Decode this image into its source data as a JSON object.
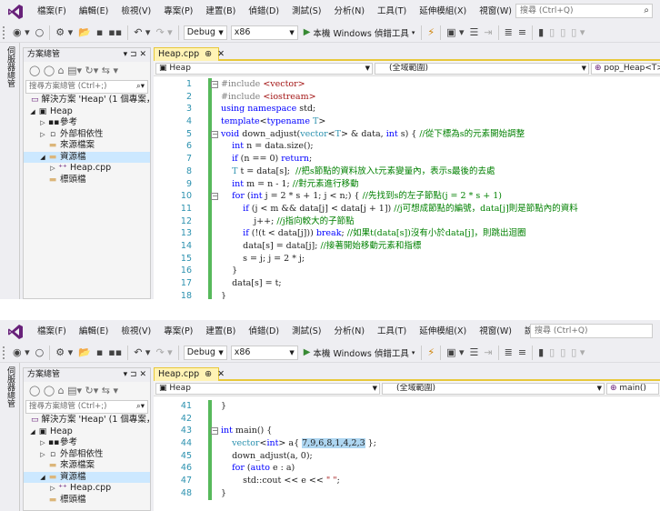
{
  "menu": {
    "items": [
      "檔案(F)",
      "編輯(E)",
      "檢視(V)",
      "專案(P)",
      "建置(B)",
      "偵錯(D)",
      "測試(S)",
      "分析(N)",
      "工具(T)",
      "延伸模組(X)",
      "視窗(W)",
      "說明(H)"
    ],
    "quick_launch_placeholder": "搜尋 (Ctrl+Q)"
  },
  "toolbar": {
    "config": "Debug",
    "platform": "x86",
    "run_label": "本機 Windows 偵錯工具"
  },
  "left_strip": {
    "label": "伺服器總管"
  },
  "solution_explorer": {
    "title": "方案總管",
    "pin": "▾ ⊐ ✕",
    "search_placeholder": "搜尋方案總管 (Ctrl+;)",
    "tree": [
      {
        "label": "解決方案 'Heap' (1 個專案，共",
        "icon": "solution-icon",
        "depth": 0,
        "exp": ""
      },
      {
        "label": "Heap",
        "icon": "project-icon",
        "depth": 0,
        "exp": "◢"
      },
      {
        "label": "參考",
        "icon": "references-icon",
        "depth": 1,
        "exp": "▷"
      },
      {
        "label": "外部相依性",
        "icon": "external-deps-icon",
        "depth": 1,
        "exp": "▷"
      },
      {
        "label": "來源檔案",
        "icon": "folder-icon",
        "depth": 1,
        "exp": ""
      },
      {
        "label": "資源檔",
        "icon": "folder-icon",
        "depth": 1,
        "exp": "◢"
      },
      {
        "label": "Heap.cpp",
        "icon": "cpp-file-icon",
        "depth": 2,
        "exp": "▷"
      },
      {
        "label": "標頭檔",
        "icon": "folder-icon",
        "depth": 1,
        "exp": ""
      }
    ]
  },
  "editor_top": {
    "tab": {
      "label": "Heap.cpp",
      "pin": "⊕",
      "close": "✕"
    },
    "nav": {
      "project": "Heap",
      "scope": "(全域範圍)",
      "member": "pop_Heap<T>"
    },
    "lines": [
      {
        "n": "1",
        "code": [
          [
            "pp",
            "#include "
          ],
          [
            "str",
            "<vector>"
          ]
        ]
      },
      {
        "n": "2",
        "code": [
          [
            "pp",
            "#include "
          ],
          [
            "str",
            "<iostream>"
          ]
        ]
      },
      {
        "n": "3",
        "code": [
          [
            "kw",
            "using namespace "
          ],
          [
            "",
            "std;"
          ]
        ]
      },
      {
        "n": "4",
        "code": [
          [
            "kw",
            "template"
          ],
          [
            "",
            "<"
          ],
          [
            "kw",
            "typename "
          ],
          [
            "ty",
            "T"
          ],
          [
            "",
            ">"
          ]
        ]
      },
      {
        "n": "5",
        "code": [
          [
            "kw",
            "void "
          ],
          [
            "",
            "down_adjust("
          ],
          [
            "ty",
            "vector"
          ],
          [
            "",
            "<"
          ],
          [
            "ty",
            "T"
          ],
          [
            "",
            "> & data, "
          ],
          [
            "kw",
            "int "
          ],
          [
            "",
            "s) { "
          ],
          [
            "cm",
            "//從下標為s的元素開始調整"
          ]
        ]
      },
      {
        "n": "6",
        "code": [
          [
            "kw",
            "    int "
          ],
          [
            "",
            "n = data.size();"
          ]
        ]
      },
      {
        "n": "7",
        "code": [
          [
            "kw",
            "    if "
          ],
          [
            "",
            "(n == 0) "
          ],
          [
            "kw",
            "return"
          ],
          [
            "",
            ";"
          ]
        ]
      },
      {
        "n": "8",
        "code": [
          [
            "ty",
            "    T "
          ],
          [
            "",
            "t = data[s];  "
          ],
          [
            "cm",
            "//把s節點的資料放入t元素變量內，表示s最後的去處"
          ]
        ]
      },
      {
        "n": "9",
        "code": [
          [
            "kw",
            "    int "
          ],
          [
            "",
            "m = n - 1; "
          ],
          [
            "cm",
            "//對元素進行移動"
          ]
        ]
      },
      {
        "n": "10",
        "code": [
          [
            "kw",
            "    for "
          ],
          [
            "",
            "("
          ],
          [
            "kw",
            "int "
          ],
          [
            "",
            "j = 2 * s + 1; j < n;) { "
          ],
          [
            "cm",
            "//先找到s的左子節點(j = 2 * s + 1)"
          ]
        ]
      },
      {
        "n": "11",
        "code": [
          [
            "kw",
            "        if "
          ],
          [
            "",
            "(j < m && data[j] < data[j + 1]) "
          ],
          [
            "cm",
            "//j可想成節點的編號，data[j]則是節點內的資料"
          ]
        ]
      },
      {
        "n": "12",
        "code": [
          [
            "",
            "            j++; "
          ],
          [
            "cm",
            "//j指向較大的子節點"
          ]
        ]
      },
      {
        "n": "13",
        "code": [
          [
            "kw",
            "        if "
          ],
          [
            "",
            "(!(t < data[j])) "
          ],
          [
            "kw",
            "break"
          ],
          [
            "",
            "; "
          ],
          [
            "cm",
            "//如果t(data[s])沒有小於data[j]，則跳出迴圈"
          ]
        ]
      },
      {
        "n": "14",
        "code": [
          [
            "",
            "        data[s] = data[j]; "
          ],
          [
            "cm",
            "//接著開始移動元素和指標"
          ]
        ]
      },
      {
        "n": "15",
        "code": [
          [
            "",
            "        s = j; j = 2 * j;"
          ]
        ]
      },
      {
        "n": "16",
        "code": [
          [
            "",
            "    }"
          ]
        ]
      },
      {
        "n": "17",
        "code": [
          [
            "",
            "    data[s] = t;"
          ]
        ]
      },
      {
        "n": "18",
        "code": [
          [
            "",
            "}"
          ]
        ]
      }
    ]
  },
  "editor_bottom": {
    "tab": {
      "label": "Heap.cpp",
      "pin": "⊕",
      "close": "✕"
    },
    "nav": {
      "project": "Heap",
      "scope": "(全域範圍)",
      "member": "main()"
    },
    "lines": [
      {
        "n": "41",
        "code": [
          [
            "",
            "}"
          ]
        ]
      },
      {
        "n": "42",
        "code": [
          [
            "",
            ""
          ]
        ]
      },
      {
        "n": "43",
        "code": [
          [
            "kw",
            "int "
          ],
          [
            "",
            "main() {"
          ]
        ]
      },
      {
        "n": "44",
        "code": [
          [
            "ty",
            "    vector"
          ],
          [
            "",
            "<"
          ],
          [
            "kw",
            "int"
          ],
          [
            "",
            "> a{ "
          ],
          [
            "hl",
            "7,9,6,8,1,4,2,3"
          ],
          [
            "",
            " };"
          ]
        ]
      },
      {
        "n": "45",
        "code": [
          [
            "",
            "    down_adjust(a, 0);"
          ]
        ]
      },
      {
        "n": "46",
        "code": [
          [
            "kw",
            "    for "
          ],
          [
            "",
            "("
          ],
          [
            "kw",
            "auto "
          ],
          [
            "",
            "e : a)"
          ]
        ]
      },
      {
        "n": "47",
        "code": [
          [
            "",
            "        std::cout << e << "
          ],
          [
            "str",
            "\" \""
          ],
          [
            "",
            ";"
          ]
        ]
      },
      {
        "n": "48",
        "code": [
          [
            "",
            "}"
          ]
        ]
      }
    ]
  }
}
